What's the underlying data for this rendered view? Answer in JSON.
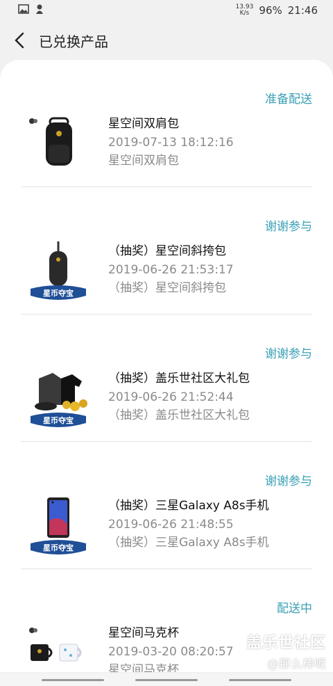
{
  "status_bar": {
    "network_speed": "13.93 K/s",
    "battery": "96%",
    "time": "21:46"
  },
  "header": {
    "title": "已兑换产品"
  },
  "items": [
    {
      "status": "准备配送",
      "name": "星空间双肩包",
      "date": "2019-07-13 18:12:16",
      "desc": "星空间双肩包",
      "thumb_icon": "backpack-icon",
      "badge": ""
    },
    {
      "status": "谢谢参与",
      "name": "（抽奖）星空间斜挎包",
      "date": "2019-06-26 21:53:17",
      "desc": "（抽奖）星空间斜挎包",
      "thumb_icon": "sling-bag-icon",
      "badge": "星币夺宝"
    },
    {
      "status": "谢谢参与",
      "name": "（抽奖）盖乐世社区大礼包",
      "date": "2019-06-26 21:52:44",
      "desc": "（抽奖）盖乐世社区大礼包",
      "thumb_icon": "gift-pack-icon",
      "badge": "星币夺宝"
    },
    {
      "status": "谢谢参与",
      "name": "（抽奖）三星Galaxy A8s手机",
      "date": "2019-06-26 21:48:55",
      "desc": "（抽奖）三星Galaxy A8s手机",
      "thumb_icon": "phone-icon",
      "badge": "星币夺宝"
    },
    {
      "status": "配送中",
      "name": "星空间马克杯",
      "date": "2019-03-20 08:20:57",
      "desc": "星空间马克杯",
      "thumb_icon": "mug-icon",
      "badge": ""
    }
  ],
  "watermark": {
    "main": "盖乐世社区",
    "sub": "@那么棒呢"
  },
  "colors": {
    "status_text": "#3aa0b6",
    "badge_blue": "#1f4f96"
  }
}
